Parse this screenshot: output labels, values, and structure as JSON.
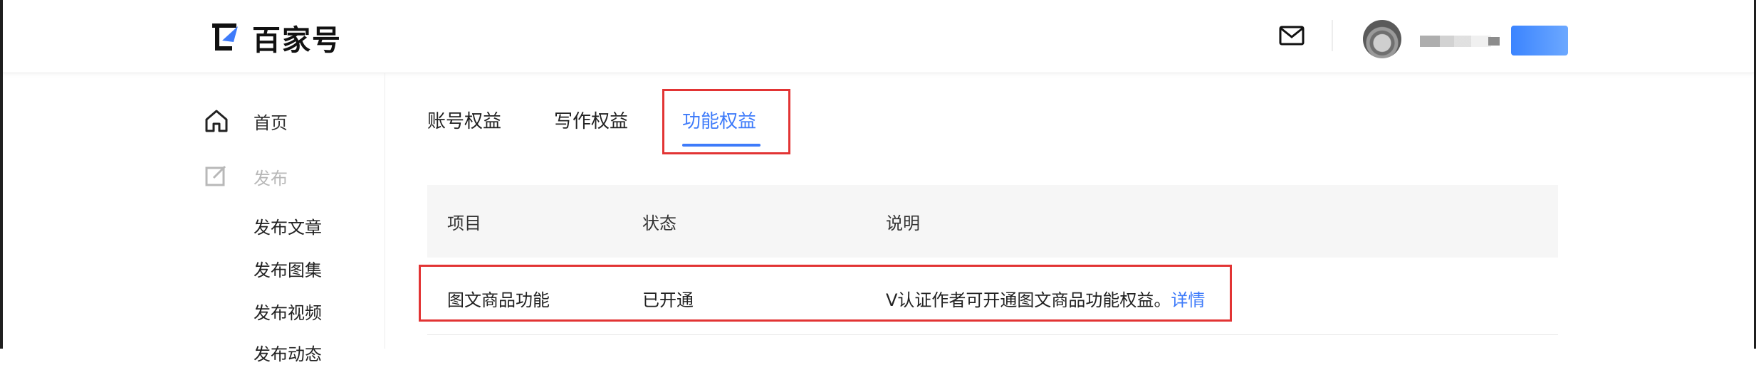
{
  "header": {
    "brand": "百家号",
    "icons": {
      "mail": "mail-icon"
    }
  },
  "sidebar": {
    "items": [
      {
        "label": "首页",
        "icon": "home-icon"
      },
      {
        "label": "发布",
        "icon": "edit-icon"
      }
    ],
    "subitems": [
      "发布文章",
      "发布图集",
      "发布视频",
      "发布动态"
    ]
  },
  "tabs": [
    {
      "label": "账号权益"
    },
    {
      "label": "写作权益"
    },
    {
      "label": "功能权益"
    }
  ],
  "table": {
    "headers": [
      "项目",
      "状态",
      "说明"
    ],
    "rows": [
      {
        "item": "图文商品功能",
        "status": "已开通",
        "desc": "V认证作者可开通图文商品功能权益。",
        "link": "详情"
      }
    ]
  },
  "colors": {
    "accent": "#3e7bfa",
    "highlight": "#e23434",
    "header_bg": "#f6f6f6"
  }
}
